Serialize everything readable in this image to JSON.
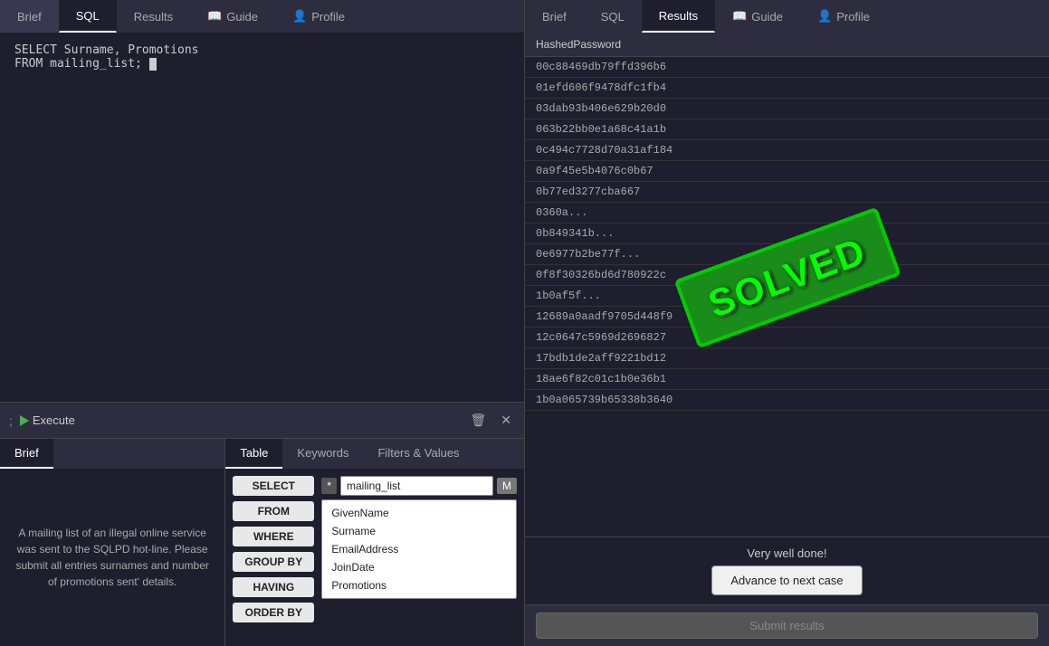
{
  "left_tabs": [
    {
      "label": "Brief",
      "active": false
    },
    {
      "label": "SQL",
      "active": true
    },
    {
      "label": "Results",
      "active": false
    },
    {
      "label": "Guide",
      "active": false,
      "icon": "book"
    },
    {
      "label": "Profile",
      "active": false,
      "icon": "person"
    }
  ],
  "right_tabs": [
    {
      "label": "Brief",
      "active": false
    },
    {
      "label": "SQL",
      "active": false
    },
    {
      "label": "Results",
      "active": true
    },
    {
      "label": "Guide",
      "active": false,
      "icon": "book"
    },
    {
      "label": "Profile",
      "active": false,
      "icon": "person"
    }
  ],
  "sql_code": "SELECT Surname, Promotions\nFROM mailing_list;",
  "toolbar": {
    "execute_label": "Execute",
    "semicolon": ";"
  },
  "brief": {
    "tab_label": "Brief",
    "content": "A mailing list of an illegal online service was sent to the SQLPD hot-line. Please submit all entries surnames and number of promotions sent' details."
  },
  "table_tabs": [
    {
      "label": "Table",
      "active": true
    },
    {
      "label": "Keywords",
      "active": false
    },
    {
      "label": "Filters & Values",
      "active": false
    }
  ],
  "keywords": [
    "SELECT",
    "FROM",
    "WHERE",
    "GROUP BY",
    "HAVING",
    "ORDER BY"
  ],
  "table_selector": {
    "star": "*",
    "table_name": "mailing_list",
    "m_btn": "M",
    "fields": [
      "GivenName",
      "Surname",
      "EmailAddress",
      "JoinDate",
      "Promotions"
    ]
  },
  "results": {
    "column": "HashedPassword",
    "rows": [
      "00c88469db79ffd396b6",
      "01efd606f9478dfc1fb4",
      "03dab93b406e629b20d0",
      "063b22bb0e1a68c41a1b",
      "0c494c7728d70a31af184",
      "0a9f45e5b4076c0b67",
      "0b77ed3277cba667",
      "0360a...",
      "0b849341b...",
      "0e6977b2be77f...",
      "0f8f30326bd6d780922c",
      "1b0af5f...",
      "12689a0aadf9705d448f9",
      "12c0647c5969d2696827",
      "17bdb1de2aff9221bd12",
      "18ae6f82c01c1b0e36b1",
      "1b0a065739b65338b3640"
    ]
  },
  "solved": {
    "text": "SOLVED",
    "well_done": "Very well done!"
  },
  "advance_btn_label": "Advance to next case",
  "submit_btn_label": "Submit results"
}
